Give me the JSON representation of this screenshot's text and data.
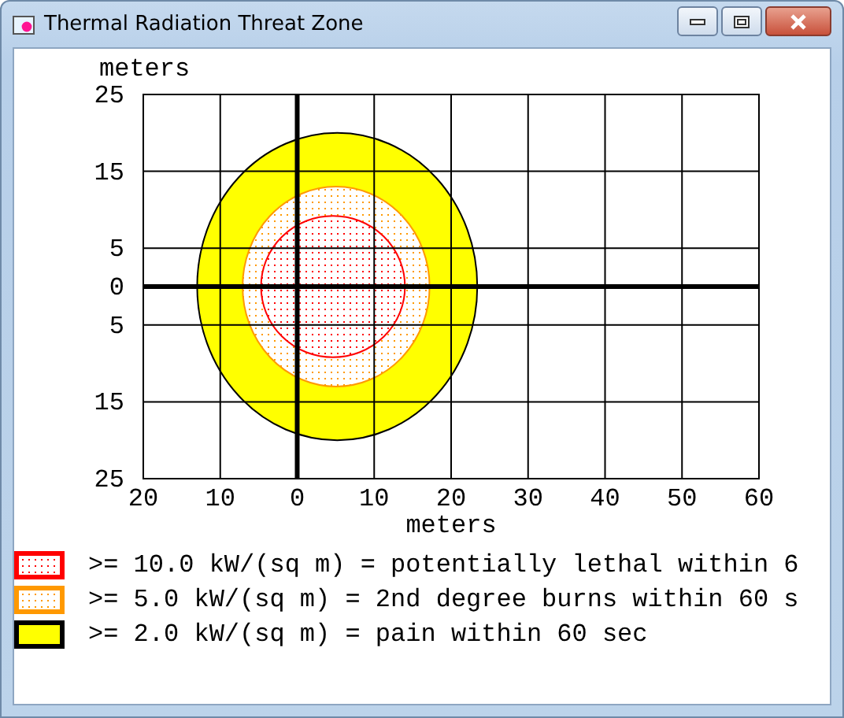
{
  "window": {
    "title": "Thermal Radiation Threat Zone"
  },
  "chart": {
    "chart_data": {
      "type": "area",
      "xlabel": "meters",
      "ylabel": "meters",
      "xlim": [
        -20,
        60
      ],
      "ylim": [
        -25,
        25
      ],
      "xticks": [
        {
          "value": -20,
          "label": "20"
        },
        {
          "value": -10,
          "label": "10"
        },
        {
          "value": 0,
          "label": "0"
        },
        {
          "value": 10,
          "label": "10"
        },
        {
          "value": 20,
          "label": "20"
        },
        {
          "value": 30,
          "label": "30"
        },
        {
          "value": 40,
          "label": "40"
        },
        {
          "value": 50,
          "label": "50"
        },
        {
          "value": 60,
          "label": "60"
        }
      ],
      "yticks": [
        {
          "value": 25,
          "label": "25"
        },
        {
          "value": 15,
          "label": "15"
        },
        {
          "value": 5,
          "label": "5"
        },
        {
          "value": 0,
          "label": "0"
        },
        {
          "value": -5,
          "label": "5"
        },
        {
          "value": -15,
          "label": "15"
        },
        {
          "value": -25,
          "label": "25"
        }
      ],
      "grid": true,
      "series": [
        {
          "color": "#ff0000",
          "x": [
            -4.7,
            4.65,
            14,
            4.65,
            -4.7
          ],
          "values": [
            0,
            9.2,
            0,
            -9.2,
            0
          ]
        },
        {
          "color": "#ff9900",
          "x": [
            -7.1,
            5.05,
            17.2,
            5.05,
            -7.1
          ],
          "values": [
            0,
            13,
            0,
            -13,
            0
          ]
        },
        {
          "color": "#ffff00",
          "x": [
            -13,
            5.2,
            23.4,
            5.2,
            -13
          ],
          "values": [
            0,
            20,
            0,
            -20,
            0
          ]
        }
      ]
    }
  },
  "legend": [
    {
      "kind": "dotted",
      "color": "#ff0000",
      "text": ">= 10.0 kW/(sq m) = potentially lethal within 6"
    },
    {
      "kind": "dotted",
      "color": "#ff9900",
      "text": ">= 5.0 kW/(sq m) = 2nd degree burns within 60 s"
    },
    {
      "kind": "solid",
      "color": "#ffff00",
      "text": ">= 2.0 kW/(sq m) = pain within 60 sec"
    }
  ]
}
